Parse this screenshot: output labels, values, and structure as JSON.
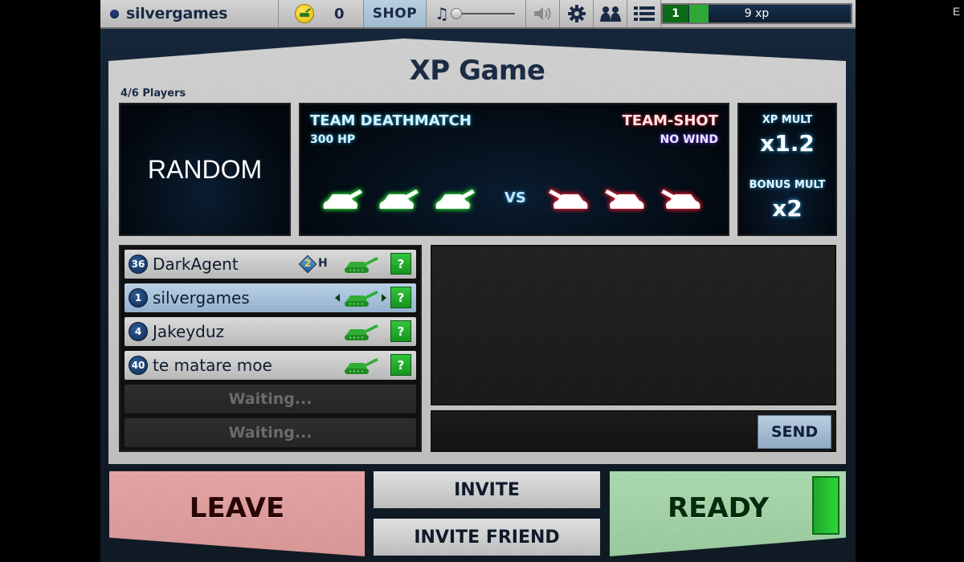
{
  "topbar": {
    "username": "silvergames",
    "coins": "0",
    "shop_label": "SHOP",
    "music_icon": "music-note-icon",
    "music_volume": 0,
    "icons": [
      "speaker-icon",
      "gear-icon",
      "friends-icon",
      "list-icon"
    ],
    "level": "1",
    "xp_text": "9 xp",
    "xp_progress": 0.12
  },
  "edge_letter": "E",
  "lobby": {
    "title": "XP Game",
    "players_count": "4/6 Players",
    "map": "RANDOM",
    "mode": {
      "name": "TEAM DEATHMATCH",
      "hp": "300 HP",
      "shot_type": "TEAM-SHOT",
      "wind": "NO WIND",
      "vs_label": "VS",
      "team_green_count": 3,
      "team_red_count": 3
    },
    "multipliers": {
      "xp_label": "XP MULT",
      "xp_value": "x1.2",
      "bonus_label": "BONUS MULT",
      "bonus_value": "x2"
    }
  },
  "players": [
    {
      "level": "36",
      "name": "DarkAgent",
      "rank_number": "2",
      "rank_letter": "H",
      "is_self": false,
      "help": "?"
    },
    {
      "level": "1",
      "name": "silvergames",
      "is_self": true,
      "help": "?"
    },
    {
      "level": "4",
      "name": "Jakeyduz",
      "is_self": false,
      "help": "?"
    },
    {
      "level": "40",
      "name": "te matare moe",
      "is_self": false,
      "help": "?"
    }
  ],
  "waiting_slots": [
    "Waiting...",
    "Waiting..."
  ],
  "chat": {
    "input_value": "",
    "send_label": "SEND"
  },
  "buttons": {
    "leave": "LEAVE",
    "invite": "INVITE",
    "invite_friend": "INVITE FRIEND",
    "ready": "READY"
  },
  "colors": {
    "green_team": "#23c42e",
    "red_team": "#d01a2a",
    "ready_green": "#2fd43b",
    "leave_red": "#e3a3a3"
  }
}
